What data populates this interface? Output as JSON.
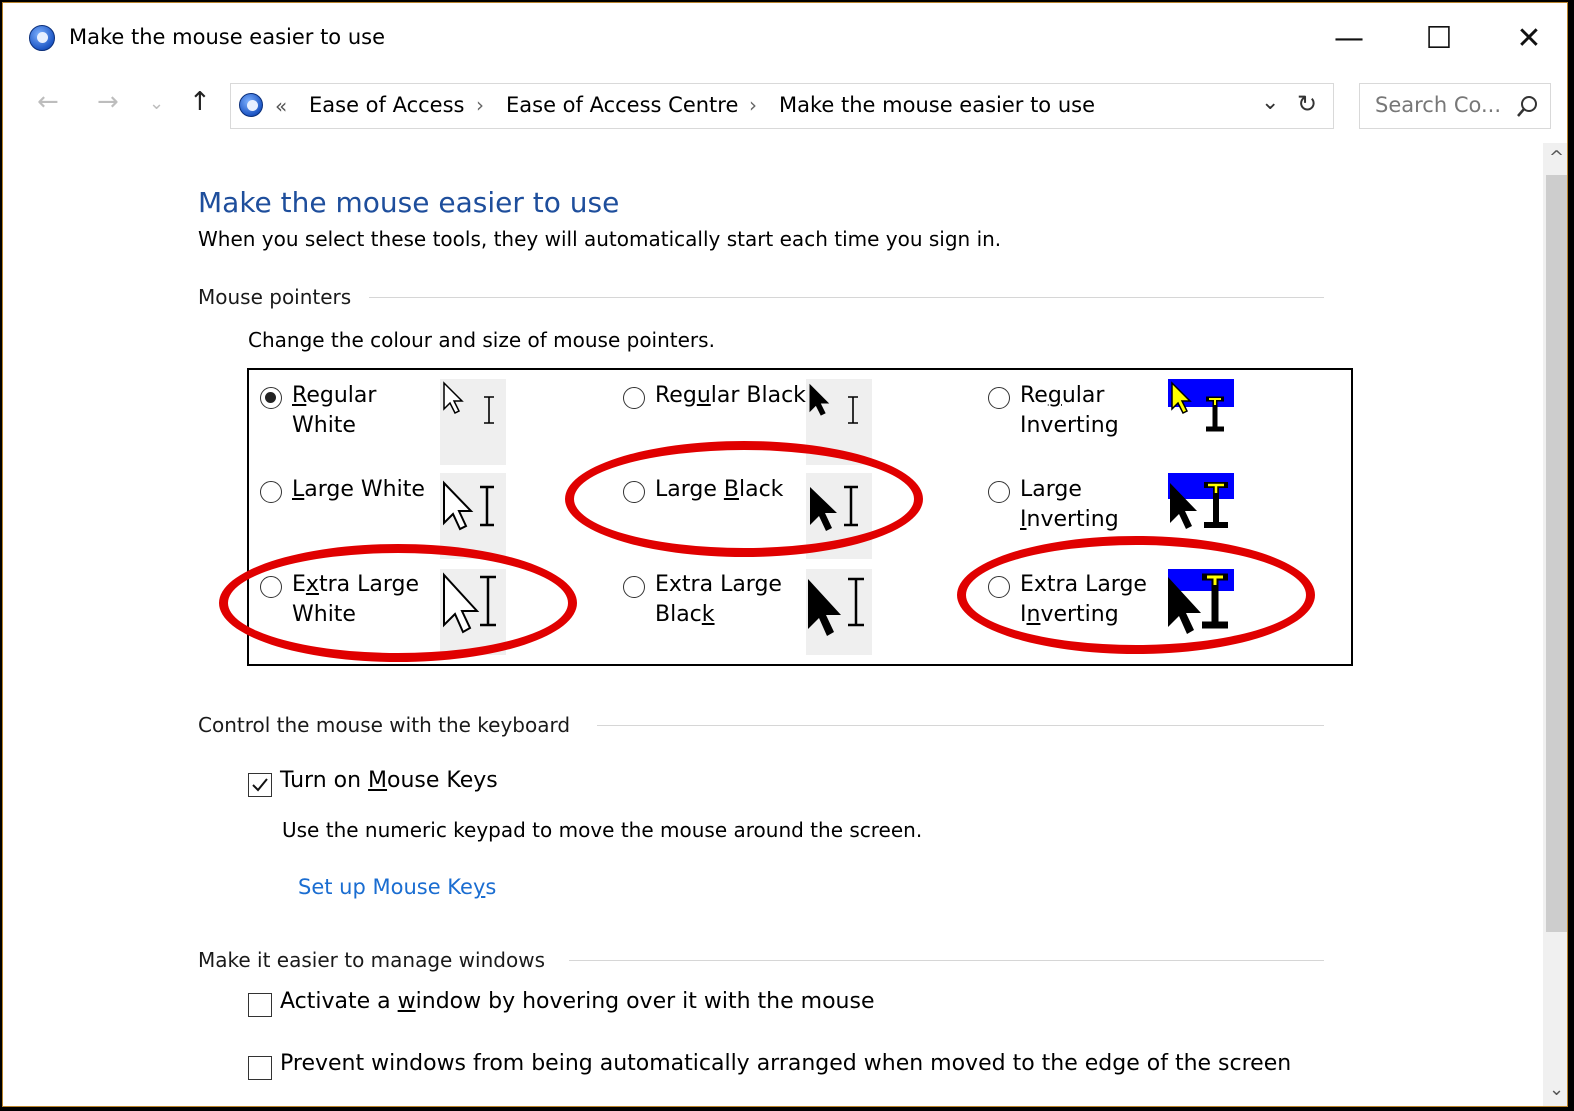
{
  "window": {
    "title": "Make the mouse easier to use",
    "controls": {
      "minimize": "—",
      "maximize": "☐",
      "close": "✕"
    }
  },
  "nav": {
    "back": "←",
    "forward": "→",
    "recent": "⌄",
    "up": "↑"
  },
  "address": {
    "overflow": "«",
    "crumbs": [
      "Ease of Access",
      "Ease of Access Centre",
      "Make the mouse easier to use"
    ],
    "separator": "›",
    "dropdown": "⌄",
    "refresh": "↻"
  },
  "search": {
    "placeholder": "Search Co...",
    "icon": "search-icon"
  },
  "page": {
    "heading": "Make the mouse easier to use",
    "subheading": "When you select these tools, they will automatically start each time you sign in."
  },
  "pointers_section": {
    "title": "Mouse pointers",
    "description": "Change the colour and size of mouse pointers.",
    "options": [
      {
        "id": "regular-white",
        "line1_pre": "",
        "line1_u": "R",
        "line1_post": "egular",
        "line2_pre": "White",
        "line2_u": "",
        "line2_post": "",
        "selected": true
      },
      {
        "id": "regular-black",
        "line1_pre": "Reg",
        "line1_u": "u",
        "line1_post": "lar Black",
        "line2_pre": "",
        "line2_u": "",
        "line2_post": "",
        "selected": false
      },
      {
        "id": "regular-inverting",
        "line1_pre": "Re",
        "line1_u": "g",
        "line1_post": "ular",
        "line2_pre": "Inverting",
        "line2_u": "",
        "line2_post": "",
        "selected": false
      },
      {
        "id": "large-white",
        "line1_pre": "",
        "line1_u": "L",
        "line1_post": "arge White",
        "line2_pre": "",
        "line2_u": "",
        "line2_post": "",
        "selected": false
      },
      {
        "id": "large-black",
        "line1_pre": "Large ",
        "line1_u": "B",
        "line1_post": "lack",
        "line2_pre": "",
        "line2_u": "",
        "line2_post": "",
        "selected": false
      },
      {
        "id": "large-inverting",
        "line1_pre": "Large",
        "line1_u": "",
        "line1_post": "",
        "line2_pre": "",
        "line2_u": "I",
        "line2_post": "nverting",
        "selected": false
      },
      {
        "id": "extra-large-white",
        "line1_pre": "E",
        "line1_u": "x",
        "line1_post": "tra Large",
        "line2_pre": "White",
        "line2_u": "",
        "line2_post": "",
        "selected": false
      },
      {
        "id": "extra-large-black",
        "line1_pre": "Extra Large",
        "line1_u": "",
        "line1_post": "",
        "line2_pre": "Blac",
        "line2_u": "k",
        "line2_post": "",
        "selected": false
      },
      {
        "id": "extra-large-inverting",
        "line1_pre": "Extra Large",
        "line1_u": "",
        "line1_post": "",
        "line2_pre": "I",
        "line2_u": "n",
        "line2_post": "verting",
        "selected": false
      }
    ],
    "highlighted": [
      "large-black",
      "extra-large-white",
      "extra-large-inverting"
    ],
    "highlight_color": "#e00000"
  },
  "keyboard_section": {
    "title": "Control the mouse with the keyboard",
    "mouse_keys": {
      "pre": "Turn on ",
      "u": "M",
      "post": "ouse Keys",
      "checked": true
    },
    "description": "Use the numeric keypad to move the mouse around the screen.",
    "setup_link": {
      "pre": "Set up Mouse Ke",
      "u": "y",
      "post": "s"
    }
  },
  "windows_section": {
    "title": "Make it easier to manage windows",
    "hover_activate": {
      "pre": "Activate a ",
      "u": "w",
      "post": "indow by hovering over it with the mouse",
      "checked": false
    },
    "prevent_arrange": {
      "pre": "Prevent windows from being automatically arranged when moved to the edge of the screen",
      "u": "",
      "post": "",
      "checked": false
    }
  },
  "scrollbar": {
    "up": "^",
    "down": "⌄"
  },
  "colors": {
    "link": "#1a6dd1",
    "heading": "#1e4e9c",
    "inverting_band": "#0000ff",
    "inverting_accent": "#ffff00"
  }
}
